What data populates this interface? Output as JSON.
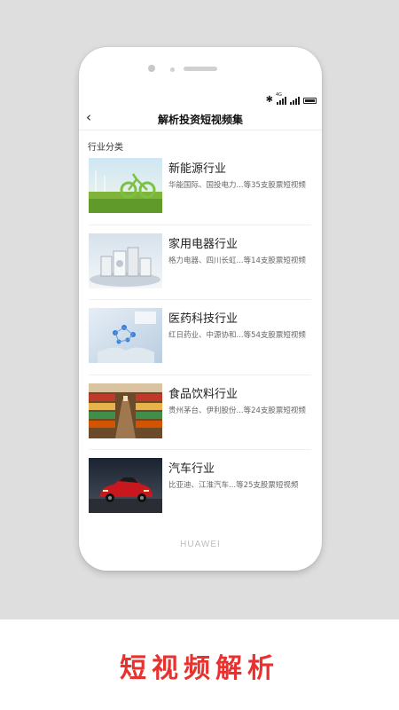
{
  "status_bar": {
    "bluetooth_icon": "bluetooth-icon",
    "signal_label": "4G",
    "battery_icon": "battery-icon"
  },
  "nav": {
    "back_icon": "back-arrow-icon",
    "back_glyph": "‹",
    "title": "解析投资短视频集"
  },
  "section_label": "行业分类",
  "industries": [
    {
      "title": "新能源行业",
      "desc": "华能国际、国投电力...等35支股票短视频",
      "image": "green-bicycle-grass"
    },
    {
      "title": "家用电器行业",
      "desc": "格力电器、四川长虹...等14支股票短视频",
      "image": "home-appliances"
    },
    {
      "title": "医药科技行业",
      "desc": "红日药业、中源协和...等54支股票短视频",
      "image": "medical-molecule-hands"
    },
    {
      "title": "食品饮料行业",
      "desc": "贵州茅台、伊利股份...等24支股票短视频",
      "image": "supermarket-aisle"
    },
    {
      "title": "汽车行业",
      "desc": "比亚迪、江淮汽车...等25支股票短视频",
      "image": "red-sports-car"
    }
  ],
  "device_brand": "HUAWEI",
  "promo_caption": "短视频解析",
  "colors": {
    "accent_red": "#e8322f",
    "text_dark": "#222222",
    "text_muted": "#666666"
  }
}
